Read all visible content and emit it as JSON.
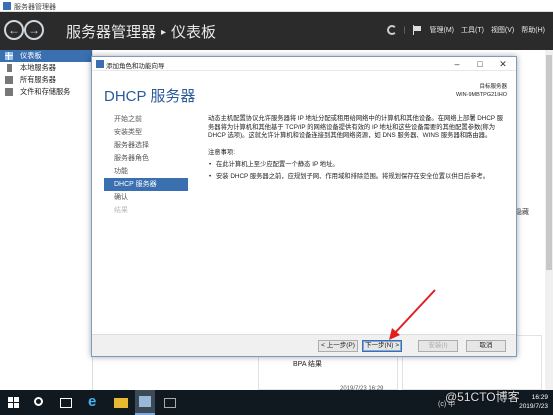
{
  "window": {
    "title": "服务器管理器"
  },
  "header": {
    "crumb_root": "服务器管理器",
    "crumb_sep": "▸",
    "crumb_page": "仪表板",
    "menu": [
      "管理(M)",
      "工具(T)",
      "视图(V)",
      "帮助(H)"
    ]
  },
  "sidebar": {
    "items": [
      {
        "label": "仪表板",
        "icon": "grid-icon"
      },
      {
        "label": "本地服务器",
        "icon": "server-icon"
      },
      {
        "label": "所有服务器",
        "icon": "servers-icon"
      },
      {
        "label": "文件和存储服务",
        "icon": "storage-icon"
      }
    ]
  },
  "background": {
    "bpa_label": "BPA 结果",
    "date_text": "2019/7/23 16:29",
    "hide_label": "隐藏"
  },
  "wizard": {
    "title": "添加角色和功能向导",
    "heading": "DHCP 服务器",
    "dest_label": "目标服务器",
    "dest_server": "WIN-9MBTPG21IHO",
    "steps": [
      {
        "label": "开始之前",
        "state": "normal"
      },
      {
        "label": "安装类型",
        "state": "normal"
      },
      {
        "label": "服务器选择",
        "state": "normal"
      },
      {
        "label": "服务器角色",
        "state": "normal"
      },
      {
        "label": "功能",
        "state": "normal"
      },
      {
        "label": "DHCP 服务器",
        "state": "active"
      },
      {
        "label": "确认",
        "state": "normal"
      },
      {
        "label": "结果",
        "state": "disabled"
      }
    ],
    "description": "动态主机配置协议允许服务器将 IP 地址分配或租用给网络中的计算机和其他设备。在网络上部署 DHCP 服务器将为计算机和其他基于 TCP/IP 的网络设备提供有效的 IP 地址和这些设备需要的其他配置参数(称为 DHCP 选项)。这就允许计算机和设备连接到其他网络资源，如 DNS 服务器、WINS 服务器和路由器。",
    "notes_title": "注意事项:",
    "notes": [
      "在此计算机上至少应配置一个静态 IP 地址。",
      "安装 DHCP 服务器之前，应规划子网、作用域和排除范围。将规划保存在安全位置以供日后参考。"
    ],
    "buttons": {
      "prev": "< 上一步(P)",
      "next": "下一步(N) >",
      "install": "安装(I)",
      "cancel": "取消"
    }
  },
  "taskbar": {
    "time": "16:29",
    "date": "2019/7/23",
    "tray_text": "(c) 中"
  },
  "watermark": "@51CTO博客",
  "colors": {
    "accent": "#3a6fb0",
    "header_bg": "#2b2b2b",
    "arrow": "#e02020"
  }
}
